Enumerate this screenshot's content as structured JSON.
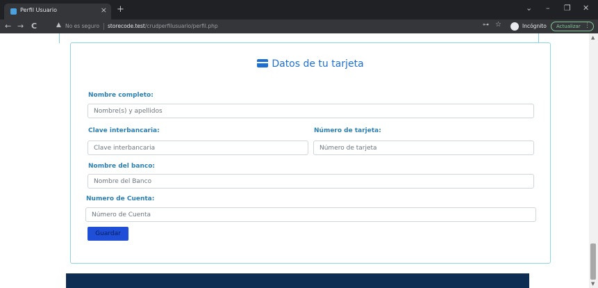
{
  "browser": {
    "tab_title": "Perfil Usuario",
    "tab_close": "×",
    "new_tab": "+",
    "window_controls": {
      "minimize": "–",
      "maximize": "❐",
      "close": "✕",
      "dropdown": "⌄"
    },
    "nav": {
      "back": "←",
      "forward": "→",
      "reload": "C"
    },
    "security_warning_icon": "warning-icon",
    "security_text": "No es seguro",
    "url_host": "storecode.test",
    "url_path": "/crudperfilusuario/perfil.php",
    "incognito_label": "Incógnito",
    "update_label": "Actualizar",
    "update_menu": "⋮"
  },
  "card": {
    "title": "Datos de tu tarjeta",
    "icon": "credit-card-icon"
  },
  "form": {
    "full_name": {
      "label": "Nombre completo:",
      "placeholder": "Nombre(s) y apellidos"
    },
    "clabe": {
      "label": "Clave interbancaria:",
      "placeholder": "Clave interbancaria"
    },
    "card_number": {
      "label": "Número de tarjeta:",
      "placeholder": "Número de tarjeta"
    },
    "bank_name": {
      "label": "Nombre del banco:",
      "placeholder": "Nombre del Banco"
    },
    "account_number": {
      "label": "Numero de Cuenta:",
      "placeholder": "Número de Cuenta"
    },
    "save_label": "Guardar"
  },
  "colors": {
    "accent": "#1d6fd1",
    "label": "#2a7fb3",
    "button": "#1e4fd6",
    "footer": "#0d2d52",
    "card_border": "#8ad6e2"
  }
}
